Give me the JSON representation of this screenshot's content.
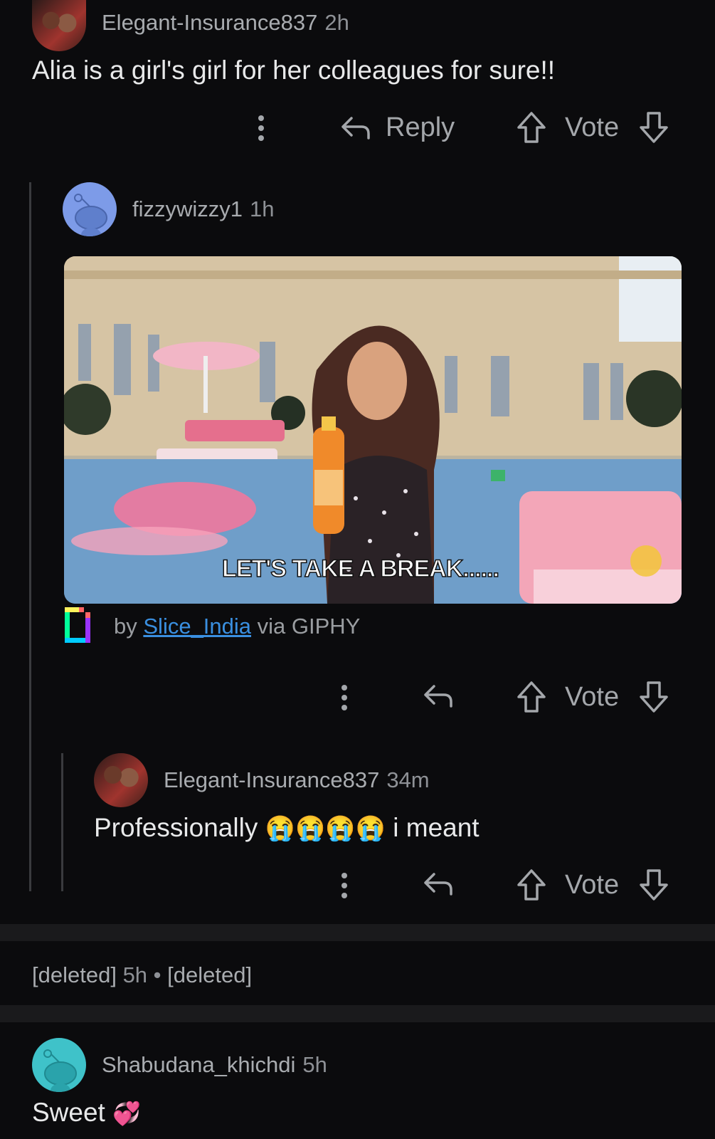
{
  "comments": [
    {
      "username": "Elegant-Insurance837",
      "time": "2h",
      "body": "Alia is a girl's girl for her colleagues for sure!!",
      "reply_label": "Reply",
      "vote_label": "Vote"
    },
    {
      "username": "fizzywizzy1",
      "time": "1h",
      "gif_caption": "LET'S TAKE A BREAK......",
      "giphy_by": "by",
      "giphy_author": "Slice_India",
      "giphy_via": "via GIPHY",
      "vote_label": "Vote"
    },
    {
      "username": "Elegant-Insurance837",
      "time": "34m",
      "body_start": "Professionally",
      "body_emoji": "😭😭😭😭",
      "body_end": "i meant",
      "vote_label": "Vote"
    }
  ],
  "deleted": {
    "author": "[deleted]",
    "time": "5h",
    "separator": "•",
    "body": "[deleted]"
  },
  "last_comment": {
    "username": "Shabudana_khichdi",
    "time": "5h",
    "body": "Sweet",
    "emoji": "💞"
  },
  "colors": {
    "background": "#0b0b0d",
    "link": "#3a8fe0",
    "text": "#e8e9ea",
    "muted": "#a9acb0"
  },
  "icons": [
    "more-icon",
    "reply-arrow-icon",
    "upvote-icon",
    "downvote-icon",
    "giphy-logo-icon",
    "snoo-avatar-icon"
  ]
}
